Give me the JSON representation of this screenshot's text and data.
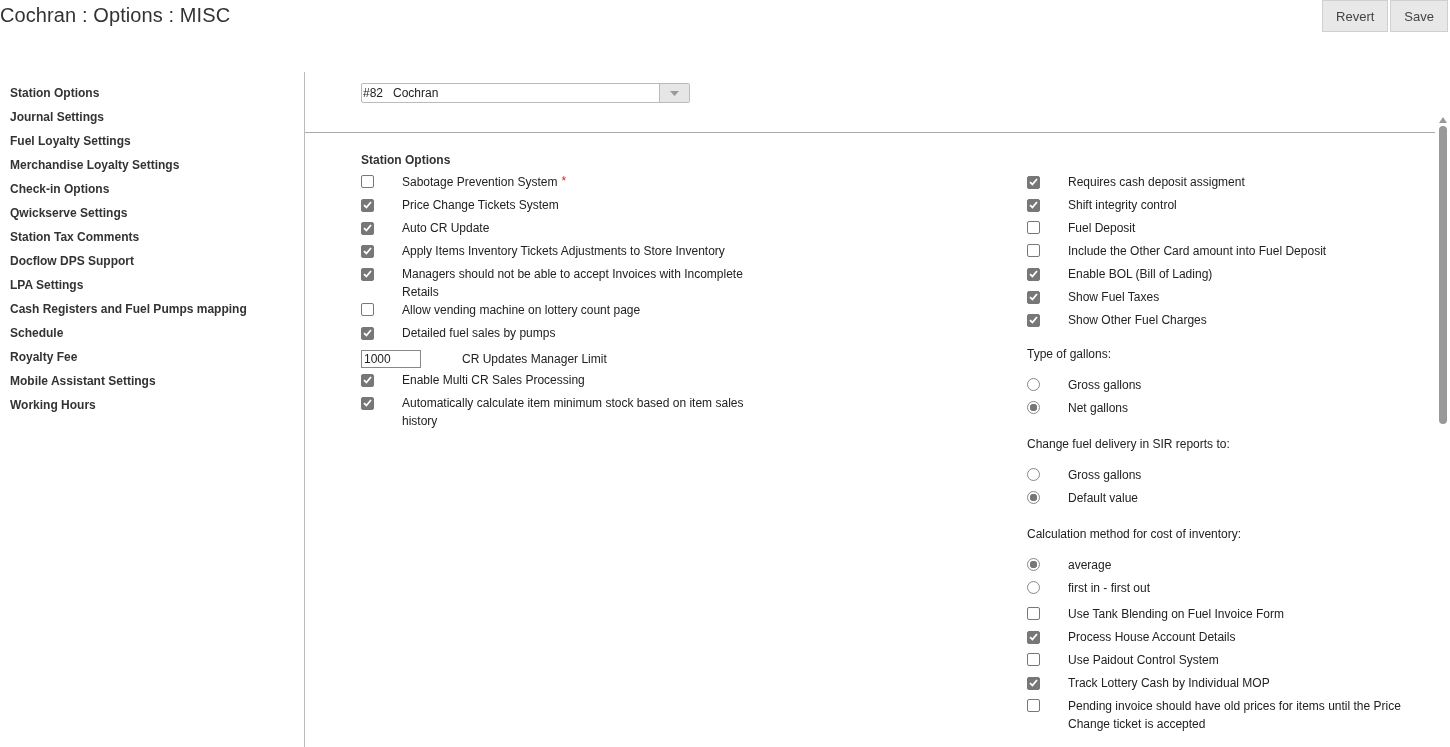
{
  "page_title": "Cochran : Options : MISC",
  "header_buttons": [
    "Revert",
    "Save"
  ],
  "sidebar": {
    "items": [
      {
        "label": "Station Options",
        "selected": false
      },
      {
        "label": "Journal Settings",
        "selected": false
      },
      {
        "label": "Fuel Loyalty Settings",
        "selected": false
      },
      {
        "label": "Merchandise Loyalty Settings",
        "selected": false
      },
      {
        "label": "Check-in Options",
        "selected": false
      },
      {
        "label": "Qwickserve Settings",
        "selected": false
      },
      {
        "label": "Station Tax Comments",
        "selected": false
      },
      {
        "label": "Docflow DPS Support",
        "selected": false
      },
      {
        "label": "LPA Settings",
        "selected": false
      },
      {
        "label": "Cash Registers and Fuel Pumps mapping",
        "selected": false
      },
      {
        "label": "Schedule",
        "selected": false
      },
      {
        "label": "Royalty Fee",
        "selected": false
      },
      {
        "label": "Mobile Assistant Settings",
        "selected": false
      },
      {
        "label": "Working Hours",
        "selected": false
      }
    ]
  },
  "station_select": {
    "value": "#82   Cochran"
  },
  "section_title": "Station Options",
  "left_column": [
    {
      "kind": "checkbox",
      "label": "Sabotage Prevention System",
      "checked": false,
      "marker": "*"
    },
    {
      "kind": "checkbox",
      "label": "Price Change Tickets System",
      "checked": true
    },
    {
      "kind": "checkbox",
      "label": "Auto CR Update",
      "checked": true
    },
    {
      "kind": "checkbox",
      "label": "Apply Items Inventory Tickets Adjustments to Store Inventory",
      "checked": true
    },
    {
      "kind": "checkbox",
      "label": "Managers should not be able to accept Invoices with Incomplete Retails",
      "checked": true
    },
    {
      "kind": "checkbox",
      "label": "Allow vending machine on lottery count page",
      "checked": false
    },
    {
      "kind": "checkbox",
      "label": "Detailed fuel sales by pumps",
      "checked": true
    },
    {
      "kind": "number",
      "label": "CR Updates Manager Limit",
      "value": "1000"
    },
    {
      "kind": "checkbox",
      "label": "Enable Multi CR Sales Processing",
      "checked": true
    },
    {
      "kind": "checkbox",
      "label": "Automatically calculate item minimum stock based on item sales history",
      "checked": true
    }
  ],
  "right_column": [
    {
      "kind": "checkbox",
      "label": "Requires cash deposit assigment",
      "checked": true
    },
    {
      "kind": "checkbox",
      "label": "Shift integrity control",
      "checked": true
    },
    {
      "kind": "checkbox",
      "label": "Fuel Deposit",
      "checked": false
    },
    {
      "kind": "checkbox",
      "label": "Include the Other Card amount into Fuel Deposit",
      "checked": false
    },
    {
      "kind": "checkbox",
      "label": "Enable BOL (Bill of Lading)",
      "checked": true
    },
    {
      "kind": "checkbox",
      "label": "Show Fuel Taxes",
      "checked": true
    },
    {
      "kind": "checkbox",
      "label": "Show Other Fuel Charges",
      "checked": true
    },
    {
      "kind": "radio_group",
      "label": "Type of gallons:",
      "options": [
        {
          "label": "Gross gallons",
          "selected": false
        },
        {
          "label": "Net gallons",
          "selected": true
        }
      ]
    },
    {
      "kind": "radio_group",
      "label": "Change fuel delivery in SIR reports to:",
      "options": [
        {
          "label": "Gross gallons",
          "selected": false
        },
        {
          "label": "Default value",
          "selected": true
        }
      ]
    },
    {
      "kind": "radio_group",
      "label": "Calculation method for cost of inventory:",
      "options": [
        {
          "label": "average",
          "selected": true
        },
        {
          "label": "first in - first out",
          "selected": false
        }
      ]
    },
    {
      "kind": "checkbox",
      "label": "Use Tank Blending on Fuel Invoice Form",
      "checked": false
    },
    {
      "kind": "checkbox",
      "label": "Process House Account Details",
      "checked": true
    },
    {
      "kind": "checkbox",
      "label": "Use Paidout Control System",
      "checked": false
    },
    {
      "kind": "checkbox",
      "label": "Track Lottery Cash by Individual MOP",
      "checked": true
    },
    {
      "kind": "checkbox",
      "label": "Pending invoice should have old prices for items until the Price Change ticket is accepted",
      "checked": false
    }
  ]
}
